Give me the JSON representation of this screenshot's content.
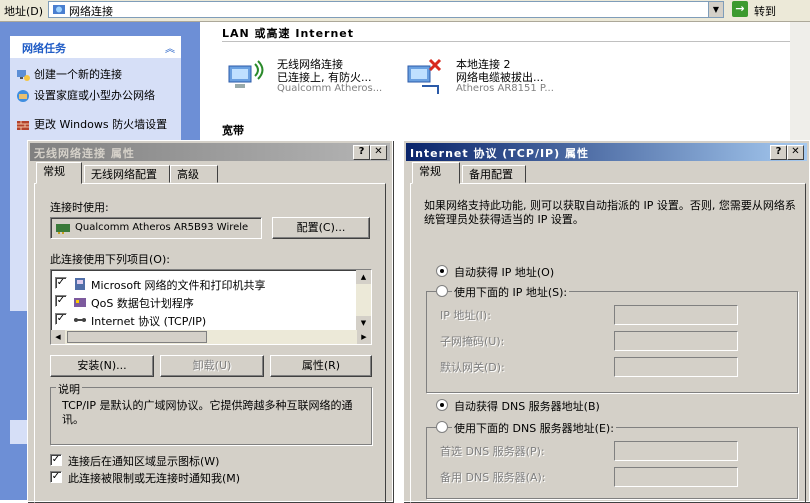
{
  "address_bar": {
    "label": "地址(D)",
    "value": "网络连接",
    "go_label": "转到"
  },
  "left_pane": {
    "task_title": "网络任务",
    "tasks": [
      "创建一个新的连接",
      "设置家庭或小型办公网络",
      "更改 Windows 防火墙设置"
    ]
  },
  "main": {
    "lan_header": "LAN 或高速 Internet",
    "broadband_header": "宽带",
    "connections": [
      {
        "name": "无线网络连接",
        "status": "已连接上, 有防火...",
        "device": "Qualcomm Atheros..."
      },
      {
        "name": "本地连接 2",
        "status": "网络电缆被拔出...",
        "device": "Atheros AR8151 P..."
      }
    ]
  },
  "dialog_wireless": {
    "title": "无线网络连接 属性",
    "tabs": [
      "常规",
      "无线网络配置",
      "高级"
    ],
    "connect_using_label": "连接时使用:",
    "adapter": "Qualcomm Atheros AR5B93 Wirele",
    "configure_button": "配置(C)...",
    "items_label": "此连接使用下列项目(O):",
    "items": [
      {
        "label": "Microsoft 网络的文件和打印机共享",
        "checked": true
      },
      {
        "label": "QoS 数据包计划程序",
        "checked": true
      },
      {
        "label": "Internet 协议 (TCP/IP)",
        "checked": true
      }
    ],
    "install_button": "安装(N)...",
    "uninstall_button": "卸载(U)",
    "properties_button": "属性(R)",
    "description_label": "说明",
    "description_text": "TCP/IP 是默认的广域网协议。它提供跨越多种互联网络的通讯。",
    "show_icon_label": "连接后在通知区域显示图标(W)",
    "notify_label": "此连接被限制或无连接时通知我(M)"
  },
  "dialog_tcpip": {
    "title": "Internet 协议 (TCP/IP) 属性",
    "tabs": [
      "常规",
      "备用配置"
    ],
    "intro": "如果网络支持此功能, 则可以获取自动指派的 IP 设置。否则, 您需要从网络系统管理员处获得适当的 IP 设置。",
    "auto_ip": "自动获得 IP 地址(O)",
    "manual_ip": "使用下面的 IP 地址(S):",
    "ip_label": "IP 地址(I):",
    "mask_label": "子网掩码(U):",
    "gateway_label": "默认网关(D):",
    "auto_dns": "自动获得 DNS 服务器地址(B)",
    "manual_dns": "使用下面的 DNS 服务器地址(E):",
    "pref_dns_label": "首选 DNS 服务器(P):",
    "alt_dns_label": "备用 DNS 服务器(A):"
  },
  "colors": {
    "dialog_bg": "#d4d0c8",
    "task_pane": "#6d8fd6",
    "task_title": "#215dc6"
  }
}
